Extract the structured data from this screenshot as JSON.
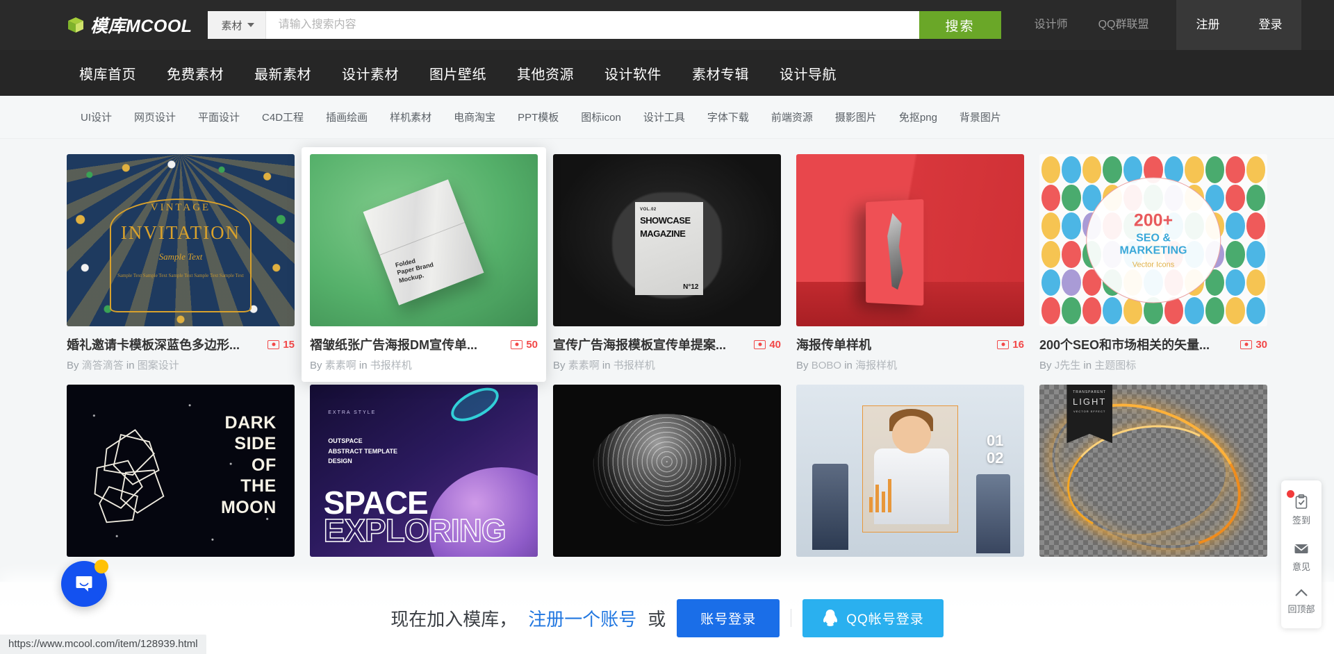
{
  "header": {
    "logo_text": "模库MCOOL",
    "logo_icon": "cube-icon",
    "category_label": "素材",
    "search_placeholder": "请输入搜索内容",
    "search_value": "",
    "search_button": "搜索",
    "links": [
      {
        "label": "设计师"
      },
      {
        "label": "QQ群联盟"
      }
    ],
    "auth": [
      {
        "label": "注册"
      },
      {
        "label": "登录"
      }
    ],
    "accent_green": "#6aa728"
  },
  "mainnav": {
    "items": [
      {
        "label": "模库首页"
      },
      {
        "label": "免费素材"
      },
      {
        "label": "最新素材"
      },
      {
        "label": "设计素材"
      },
      {
        "label": "图片壁纸"
      },
      {
        "label": "其他资源"
      },
      {
        "label": "设计软件"
      },
      {
        "label": "素材专辑"
      },
      {
        "label": "设计导航"
      }
    ]
  },
  "subnav": {
    "items": [
      {
        "label": "UI设计"
      },
      {
        "label": "网页设计"
      },
      {
        "label": "平面设计"
      },
      {
        "label": "C4D工程"
      },
      {
        "label": "插画绘画"
      },
      {
        "label": "样机素材"
      },
      {
        "label": "电商淘宝"
      },
      {
        "label": "PPT模板"
      },
      {
        "label": "图标icon"
      },
      {
        "label": "设计工具"
      },
      {
        "label": "字体下载"
      },
      {
        "label": "前端资源"
      },
      {
        "label": "摄影图片"
      },
      {
        "label": "免抠png"
      },
      {
        "label": "背景图片"
      }
    ]
  },
  "cards": [
    {
      "title": "婚礼邀请卡模板深蓝色多边形...",
      "by_prefix": "By",
      "author": "滴答滴答",
      "in_prefix": "in",
      "category": "图案设计",
      "count": "15",
      "thumb": "wedding-invitation-thumb",
      "art": {
        "t1": "VINTAGE",
        "t2": "INVITATION",
        "t3": "Sample Text",
        "t4": "Sample Text Sample Text Sample Text Sample Text Sample Text"
      }
    },
    {
      "title": "褶皱纸张广告海报DM宣传单...",
      "by_prefix": "By",
      "author": "素素啊",
      "in_prefix": "in",
      "category": "书报样机",
      "count": "50",
      "thumb": "folded-paper-mockup-thumb",
      "hovered": true,
      "art": {
        "label": "Folded\nPaper Brand\nMockup."
      }
    },
    {
      "title": "宣传广告海报模板宣传单提案...",
      "by_prefix": "By",
      "author": "素素啊",
      "in_prefix": "in",
      "category": "书报样机",
      "count": "40",
      "thumb": "showcase-magazine-thumb",
      "art": {
        "vol": "VOL.02",
        "t1": "SHOWCASE",
        "t2": "MAGAZINE",
        "num": "N°12"
      }
    },
    {
      "title": "海报传单样机",
      "by_prefix": "By",
      "author": "BOBO",
      "in_prefix": "in",
      "category": "海报样机",
      "count": "16",
      "thumb": "red-poster-mockup-thumb"
    },
    {
      "title": "200个SEO和市场相关的矢量...",
      "by_prefix": "By",
      "author": "J先生",
      "in_prefix": "in",
      "category": "主题图标",
      "count": "30",
      "thumb": "seo-icons-thumb",
      "art": {
        "s1": "200+",
        "s2": "SEO &",
        "s3": "MARKETING",
        "s4": "Vector Icons"
      }
    },
    {
      "thumb": "dark-side-of-the-moon-thumb",
      "art": {
        "lines": "DARK\nSIDE\nOF\nTHE\nMOON"
      }
    },
    {
      "thumb": "space-exploring-thumb",
      "art": {
        "small": "EXTRA STYLE",
        "lines": "OUTSPACE\nABSTRACT TEMPLATE\nDESIGN",
        "l1": "SPACE",
        "l2": "EXPLORING"
      }
    },
    {
      "thumb": "particle-sphere-thumb"
    },
    {
      "thumb": "tech-interface-thumb",
      "art": {
        "nums": "01\n02"
      }
    },
    {
      "thumb": "transparent-light-effect-thumb",
      "art": {
        "r1": "TRANSPARENT",
        "r2": "LIGHT",
        "r3": "VECTOR EFFECT"
      }
    }
  ],
  "bottom_banner": {
    "text": "现在加入模库，",
    "register_link": "注册一个账号",
    "or": "或",
    "account_login": "账号登录",
    "qq_login": "QQ帐号登录",
    "qq_icon": "qq-penguin-icon"
  },
  "rail": {
    "items": [
      {
        "label": "签到",
        "icon": "clipboard-check-icon",
        "badge": true
      },
      {
        "label": "意见",
        "icon": "envelope-icon",
        "badge": false
      },
      {
        "label": "回顶部",
        "icon": "chevron-up-icon",
        "badge": false
      }
    ]
  },
  "chat": {
    "icon": "chat-bubble-icon",
    "badge": true
  },
  "statusbar": {
    "url": "https://www.mcool.com/item/128939.html"
  },
  "seo_icon_colors": [
    "#f6c452",
    "#4cb6e5",
    "#f6c452",
    "#4aab6e",
    "#4cb6e5",
    "#ef5a5a",
    "#4cb6e5",
    "#f6c452",
    "#4aab6e",
    "#ef5a5a",
    "#f6c452",
    "#ef5a5a",
    "#4aab6e",
    "#4cb6e5",
    "#f6c452",
    "#ef5a5a",
    "#4aab6e",
    "#a99bd6",
    "#f6c452",
    "#4cb6e5",
    "#ef5a5a",
    "#4aab6e",
    "#f6c452",
    "#4cb6e5",
    "#a99bd6",
    "#ef5a5a",
    "#4aab6e",
    "#f6c452",
    "#4cb6e5",
    "#4aab6e",
    "#f6c452",
    "#4cb6e5",
    "#ef5a5a",
    "#f6c452",
    "#ef5a5a",
    "#4aab6e",
    "#a99bd6",
    "#4cb6e5",
    "#f6c452",
    "#ef5a5a",
    "#4cb6e5",
    "#a99bd6",
    "#4aab6e",
    "#4cb6e5",
    "#4cb6e5",
    "#a99bd6",
    "#ef5a5a",
    "#4aab6e",
    "#f6c452",
    "#4cb6e5",
    "#ef5a5a",
    "#f6c452",
    "#4aab6e",
    "#4cb6e5",
    "#f6c452",
    "#ef5a5a",
    "#4aab6e",
    "#ef5a5a",
    "#4cb6e5",
    "#f6c452",
    "#4aab6e",
    "#ef5a5a",
    "#4cb6e5",
    "#4aab6e",
    "#f6c452",
    "#4cb6e5"
  ]
}
